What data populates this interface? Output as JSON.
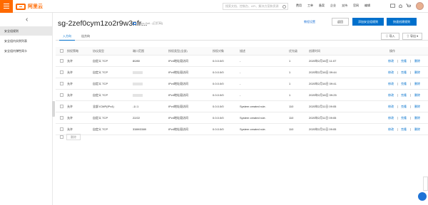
{
  "app": {
    "brand": "阿里云"
  },
  "topbar": {
    "search_placeholder": "搜索文档、控制台、API、解决方案和资源",
    "nav": [
      "费用",
      "工单",
      "备案",
      "企业",
      "支持",
      "官网",
      "编辑"
    ]
  },
  "sidebar": {
    "items": [
      {
        "label": "安全组规则"
      },
      {
        "label": "安全组内实例列表"
      },
      {
        "label": "安全组内弹性网卡"
      }
    ]
  },
  "header": {
    "title": "sg-2zef0cym1zo2r9w3nfr...",
    "subtitle": "/ vpc-2zrl...(已打码)",
    "help": "教程设置",
    "back": "返回",
    "btn_add": "添加安全组规则",
    "btn_quick": "快速创建规则"
  },
  "tabs": [
    {
      "label": "入方向"
    },
    {
      "label": "出方向"
    }
  ],
  "toolbar": {
    "import": "导入",
    "export": "导出"
  },
  "table": {
    "headers": [
      "授权策略",
      "协议类型",
      "端口范围",
      "授权类型(全部)",
      "授权对象",
      "描述",
      "优先级",
      "创建时间",
      "操作"
    ],
    "rows": [
      {
        "policy": "允许",
        "protocol": "自定义 TCP",
        "port": "80/80",
        "auth_type": "IPv4地址段访问",
        "object": "0.0.0.0/0",
        "desc": "-",
        "priority": "1",
        "time": "2020年2月16日 11:07"
      },
      {
        "policy": "允许",
        "protocol": "自定义 TCP",
        "port": "",
        "auth_type": "IPv4地址段访问",
        "object": "0.0.0.0/0",
        "desc": "-",
        "priority": "1",
        "time": "2020年2月16日 09:44"
      },
      {
        "policy": "允许",
        "protocol": "自定义 TCP",
        "port": "",
        "auth_type": "IPv4地址段访问",
        "object": "0.0.0.0/0",
        "desc": "-",
        "priority": "1",
        "time": "2020年2月16日 09:41"
      },
      {
        "policy": "允许",
        "protocol": "自定义 TCP",
        "port": "",
        "auth_type": "IPv4地址段访问",
        "object": "0.0.0.0/0",
        "desc": "-",
        "priority": "1",
        "time": "2020年2月16日 09:25"
      },
      {
        "policy": "允许",
        "protocol": "全部 ICMP(IPv4)",
        "port": "-1/-1",
        "auth_type": "IPv4地址段访问",
        "object": "0.0.0.0/0",
        "desc": "System created rule.",
        "priority": "110",
        "time": "2020年2月11日 09:05"
      },
      {
        "policy": "允许",
        "protocol": "自定义 TCP",
        "port": "22/22",
        "auth_type": "IPv4地址段访问",
        "object": "0.0.0.0/0",
        "desc": "System created rule.",
        "priority": "110",
        "time": "2020年2月11日 09:05"
      },
      {
        "policy": "允许",
        "protocol": "自定义 TCP",
        "port": "3389/3389",
        "auth_type": "IPv4地址段访问",
        "object": "0.0.0.0/0",
        "desc": "System created rule.",
        "priority": "110",
        "time": "2020年2月11日 09:05"
      }
    ],
    "actions": [
      "修改",
      "克隆",
      "删除"
    ]
  },
  "footer": {
    "delete": "删除"
  }
}
